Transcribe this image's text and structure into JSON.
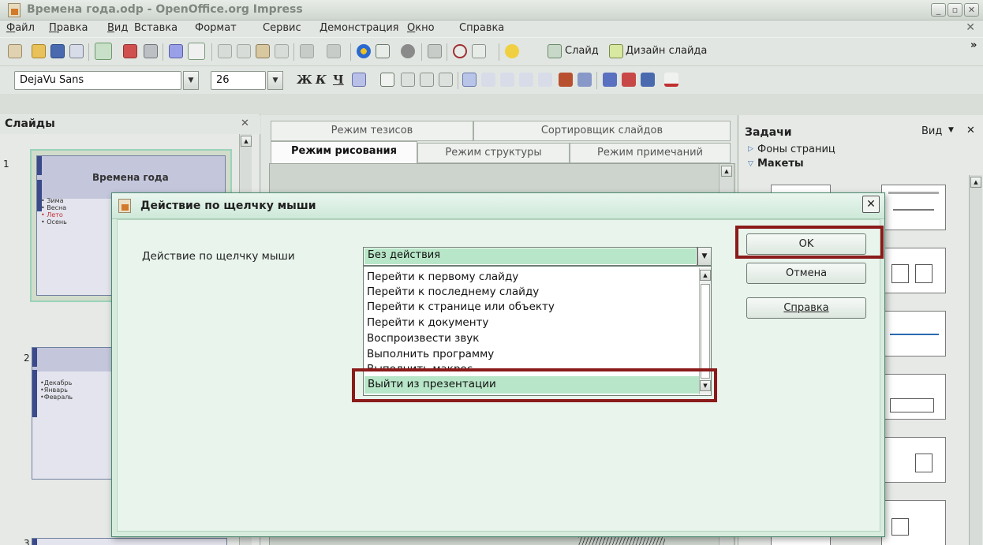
{
  "window": {
    "title": "Времена года.odp - OpenOffice.org Impress",
    "min": "_",
    "max": "▫",
    "close": "✕"
  },
  "menu": [
    "Файл",
    "Правка",
    "Вид",
    "Вставка",
    "Формат",
    "Сервис",
    "Демонстрация",
    "Окно",
    "Справка"
  ],
  "menu_close": "✕",
  "toolbar": {
    "slide_label": "Слайд",
    "design_label": "Дизайн слайда",
    "overflow": "»"
  },
  "format_toolbar": {
    "font_name": "DejaVu Sans",
    "font_size": "26",
    "bold": "Ж",
    "italic": "К",
    "underline": "Ч"
  },
  "slides_pane": {
    "title": "Слайды",
    "close": "✕",
    "slides": [
      {
        "number": "1",
        "title": "Времена года",
        "bullets": [
          "• Зима",
          "• Весна",
          "• Лето",
          "• Осень"
        ]
      },
      {
        "number": "2",
        "bullets": [
          "•Декабрь",
          "•Январь",
          "•Февраль"
        ]
      },
      {
        "number": "3"
      }
    ]
  },
  "view_tabs": {
    "row1": [
      "Режим тезисов",
      "Сортировщик слайдов"
    ],
    "row2": [
      "Режим рисования",
      "Режим структуры",
      "Режим примечаний"
    ]
  },
  "tasks_pane": {
    "title": "Задачи",
    "view_label": "Вид",
    "close": "✕",
    "section1": "Фоны страниц",
    "section2": "Макеты"
  },
  "dialog": {
    "title": "Действие по щелчку мыши",
    "close": "✕",
    "field_label": "Действие по щелчку мыши",
    "selected_value": "Без действия",
    "options": [
      "Перейти к первому слайду",
      "Перейти к последнему слайду",
      "Перейти к странице или объекту",
      "Перейти к документу",
      "Воспроизвести звук",
      "Выполнить программу",
      "Выполнить макрос",
      "Выйти из презентации"
    ],
    "highlighted_option": "Выйти из презентации",
    "ok": "OK",
    "cancel": "Отмена",
    "help": "Справка"
  },
  "colors": {
    "highlight_box": "#8b1a1a",
    "dialog_bg": "#e8f4ec",
    "selection": "#b8e6c8"
  }
}
